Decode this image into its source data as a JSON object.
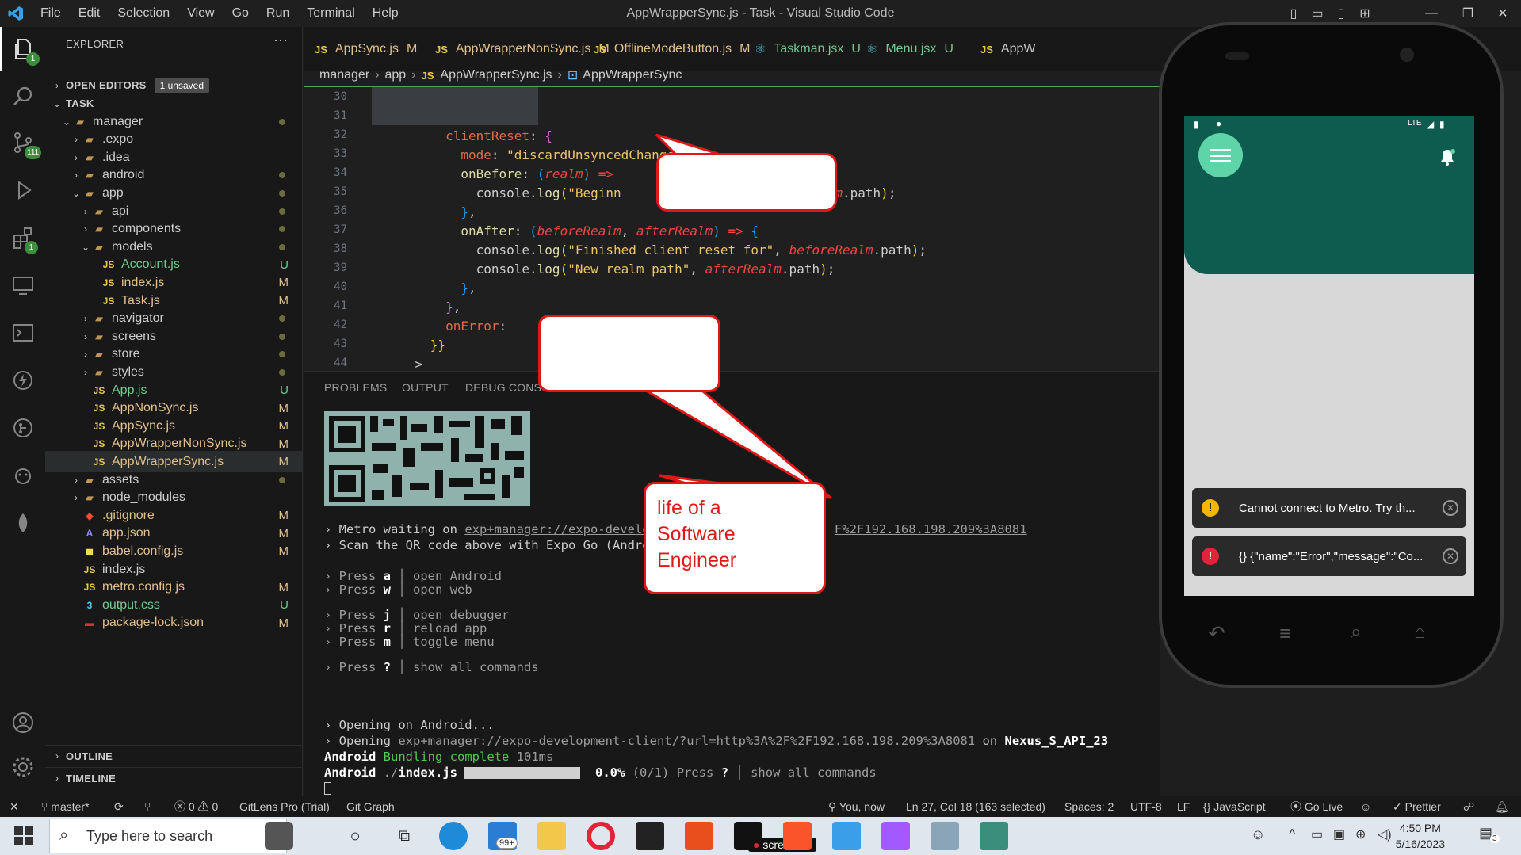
{
  "titlebar": {
    "menus": [
      "File",
      "Edit",
      "Selection",
      "View",
      "Go",
      "Run",
      "Terminal",
      "Help"
    ],
    "window_title": "AppWrapperSync.js - Task - Visual Studio Code"
  },
  "activity": {
    "scm_badge": "111",
    "explorer_badge": "1",
    "extensions_badge": "1"
  },
  "sidebar": {
    "header": "EXPLORER",
    "open_editors": "OPEN EDITORS",
    "unsaved": "1 unsaved",
    "task": "TASK",
    "items": [
      {
        "label": "manager",
        "indent": 1,
        "chev": "v",
        "icon": "folder",
        "status": "dot"
      },
      {
        "label": ".expo",
        "indent": 2,
        "chev": ">",
        "icon": "folder",
        "status": ""
      },
      {
        "label": ".idea",
        "indent": 2,
        "chev": ">",
        "icon": "folder",
        "status": ""
      },
      {
        "label": "android",
        "indent": 2,
        "chev": ">",
        "icon": "folder",
        "status": "dot"
      },
      {
        "label": "app",
        "indent": 2,
        "chev": "v",
        "icon": "folder",
        "status": "dot"
      },
      {
        "label": "api",
        "indent": 3,
        "chev": ">",
        "icon": "folder",
        "status": "dot"
      },
      {
        "label": "components",
        "indent": 3,
        "chev": ">",
        "icon": "folder",
        "status": "dot"
      },
      {
        "label": "models",
        "indent": 3,
        "chev": "v",
        "icon": "folder",
        "status": "dot"
      },
      {
        "label": "Account.js",
        "indent": 4,
        "chev": "",
        "icon": "JS",
        "status": "U"
      },
      {
        "label": "index.js",
        "indent": 4,
        "chev": "",
        "icon": "JS",
        "status": "M"
      },
      {
        "label": "Task.js",
        "indent": 4,
        "chev": "",
        "icon": "JS",
        "status": "M"
      },
      {
        "label": "navigator",
        "indent": 3,
        "chev": ">",
        "icon": "folder",
        "status": "dot"
      },
      {
        "label": "screens",
        "indent": 3,
        "chev": ">",
        "icon": "folder",
        "status": "dot"
      },
      {
        "label": "store",
        "indent": 3,
        "chev": ">",
        "icon": "folder",
        "status": "dot"
      },
      {
        "label": "styles",
        "indent": 3,
        "chev": ">",
        "icon": "folder",
        "status": "dot"
      },
      {
        "label": "App.js",
        "indent": 3,
        "chev": "",
        "icon": "JS",
        "status": "U"
      },
      {
        "label": "AppNonSync.js",
        "indent": 3,
        "chev": "",
        "icon": "JS",
        "status": "M"
      },
      {
        "label": "AppSync.js",
        "indent": 3,
        "chev": "",
        "icon": "JS",
        "status": "M"
      },
      {
        "label": "AppWrapperNonSync.js",
        "indent": 3,
        "chev": "",
        "icon": "JS",
        "status": "M"
      },
      {
        "label": "AppWrapperSync.js",
        "indent": 3,
        "chev": "",
        "icon": "JS",
        "status": "M"
      },
      {
        "label": "assets",
        "indent": 2,
        "chev": ">",
        "icon": "folder",
        "status": "dot"
      },
      {
        "label": "node_modules",
        "indent": 2,
        "chev": ">",
        "icon": "folder",
        "status": ""
      },
      {
        "label": ".gitignore",
        "indent": 2,
        "chev": "",
        "icon": "git",
        "status": "M"
      },
      {
        "label": "app.json",
        "indent": 2,
        "chev": "",
        "icon": "json",
        "status": "M"
      },
      {
        "label": "babel.config.js",
        "indent": 2,
        "chev": "",
        "icon": "babel",
        "status": "M"
      },
      {
        "label": "index.js",
        "indent": 2,
        "chev": "",
        "icon": "JS",
        "status": ""
      },
      {
        "label": "metro.config.js",
        "indent": 2,
        "chev": "",
        "icon": "JS",
        "status": "M"
      },
      {
        "label": "output.css",
        "indent": 2,
        "chev": "",
        "icon": "css",
        "status": "U"
      },
      {
        "label": "package-lock.json",
        "indent": 2,
        "chev": "",
        "icon": "npm",
        "status": "M"
      }
    ],
    "outline": "OUTLINE",
    "timeline": "TIMELINE"
  },
  "tabs": [
    {
      "label": "AppSync.js",
      "kind": "JS",
      "mod": "M"
    },
    {
      "label": "AppWrapperNonSync.js",
      "kind": "JS",
      "mod": "M"
    },
    {
      "label": "OfflineModeButton.js",
      "kind": "JS",
      "mod": "M"
    },
    {
      "label": "Taskman.jsx",
      "kind": "react",
      "mod": "U"
    },
    {
      "label": "Menu.jsx",
      "kind": "react",
      "mod": "U"
    },
    {
      "label": "AppW",
      "kind": "JS",
      "mod": ""
    }
  ],
  "breadcrumb": [
    "manager",
    "app",
    "AppWrapperSync.js",
    "AppWrapperSync"
  ],
  "editor": {
    "line_numbers": [
      "30",
      "31",
      "32",
      "33",
      "34",
      "35",
      "36",
      "37",
      "38",
      "39",
      "40",
      "41",
      "42",
      "43",
      "44"
    ]
  },
  "panel": {
    "tabs": [
      "PROBLEMS",
      "OUTPUT",
      "DEBUG CONSOLE"
    ],
    "metro_line_1a": "› Metro waiting on ",
    "metro_url_1": "exp+manager://expo-develop",
    "metro_url_1b": "F%2F192.168.198.209%3A8081",
    "scan_line": "› Scan the QR code above with Expo Go (Androi",
    "press_rows": [
      {
        "key": "a",
        "action": "open Android"
      },
      {
        "key": "w",
        "action": "open web"
      },
      {
        "key": "j",
        "action": "open debugger"
      },
      {
        "key": "r",
        "action": "reload app"
      },
      {
        "key": "m",
        "action": "toggle menu"
      },
      {
        "key": "?",
        "action": "show all commands"
      }
    ],
    "press_word": "› Press",
    "opening_1": "› Opening on Android...",
    "opening_2a": "› Opening ",
    "opening_2_url": "exp+manager://expo-development-client/?url=http%3A%2F%2F192.168.198.209%3A8081",
    "opening_2_on": " on ",
    "opening_2_device": "Nexus_S_API_23",
    "bundling_a": "Android",
    "bundling_b": "Bundling complete",
    "bundling_c": "101ms",
    "last_a": "Android",
    "last_b": "./index.js",
    "last_pct": "0.0%",
    "last_count": "(0/1)",
    "last_press": "› Press",
    "last_q": "?",
    "last_cmds": "show all commands"
  },
  "statusbar": {
    "branch": "master*",
    "errors": "0",
    "warnings": "0",
    "gitlens": "GitLens Pro (Trial)",
    "gitgraph": "Git Graph",
    "blame": "You, now",
    "position": "Ln 27, Col 18 (163 selected)",
    "spaces": "Spaces: 2",
    "encoding": "UTF-8",
    "eol": "LF",
    "language": "JavaScript",
    "golive": "Go Live",
    "prettier": "Prettier"
  },
  "taskbar": {
    "search_placeholder": "Type here to search",
    "mail_badge": "99+",
    "screenrec": "screenrec",
    "time": "4:50 PM",
    "date": "5/16/2023",
    "notif_count": "3"
  },
  "phone": {
    "toast_1": "Cannot connect to Metro.  Try th...",
    "toast_2": "{} {\"name\":\"Error\",\"message\":\"Co...",
    "status_right": "LTE"
  },
  "callout": {
    "text": "life of a\nSoftware\nEngineer"
  },
  "colors": {
    "accent": "#3b9ee8",
    "phone_header": "#0d5c4f",
    "fab": "#5fd4a8",
    "callout_border": "#e01818"
  }
}
